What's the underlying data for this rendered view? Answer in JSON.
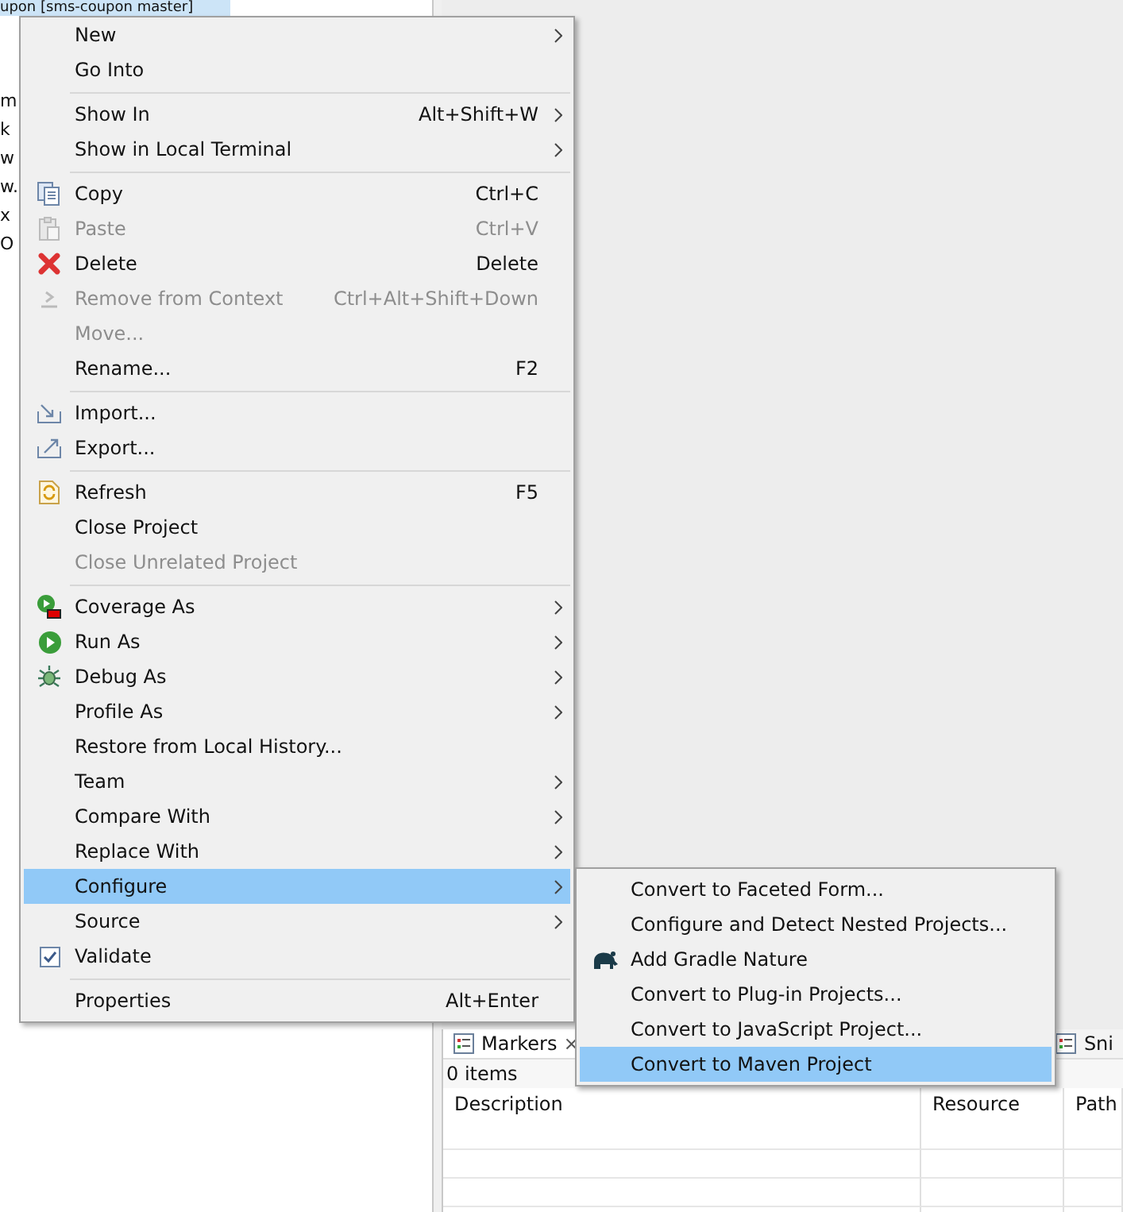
{
  "tree": {
    "selected_item": {
      "label": "upon [sms-coupon master]",
      "selected": true
    },
    "items": [
      {
        "label": "m"
      },
      {
        "label": "k"
      },
      {
        "label": "w"
      },
      {
        "label": "w."
      },
      {
        "label": "x"
      },
      {
        "label": "O"
      }
    ]
  },
  "context_menu": {
    "items": [
      {
        "kind": "item",
        "label": "New",
        "submenu": true,
        "disabled": false,
        "selected": false
      },
      {
        "kind": "item",
        "label": "Go Into",
        "submenu": false,
        "disabled": false,
        "selected": false
      },
      {
        "kind": "separator"
      },
      {
        "kind": "item",
        "label": "Show In",
        "shortcut": "Alt+Shift+W",
        "submenu": true,
        "disabled": false,
        "selected": false
      },
      {
        "kind": "item",
        "label": "Show in Local Terminal",
        "submenu": true,
        "disabled": false,
        "selected": false
      },
      {
        "kind": "separator"
      },
      {
        "kind": "item",
        "label": "Copy",
        "shortcut": "Ctrl+C",
        "submenu": false,
        "disabled": false,
        "selected": false
      },
      {
        "kind": "item",
        "label": "Paste",
        "shortcut": "Ctrl+V",
        "submenu": false,
        "disabled": true,
        "selected": false
      },
      {
        "kind": "item",
        "label": "Delete",
        "shortcut": "Delete",
        "submenu": false,
        "disabled": false,
        "selected": false
      },
      {
        "kind": "item",
        "label": "Remove from Context",
        "shortcut": "Ctrl+Alt+Shift+Down",
        "submenu": false,
        "disabled": true,
        "selected": false
      },
      {
        "kind": "item",
        "label": "Move...",
        "submenu": false,
        "disabled": true,
        "selected": false
      },
      {
        "kind": "item",
        "label": "Rename...",
        "shortcut": "F2",
        "submenu": false,
        "disabled": false,
        "selected": false
      },
      {
        "kind": "separator"
      },
      {
        "kind": "item",
        "label": "Import...",
        "submenu": false,
        "disabled": false,
        "selected": false
      },
      {
        "kind": "item",
        "label": "Export...",
        "submenu": false,
        "disabled": false,
        "selected": false
      },
      {
        "kind": "separator"
      },
      {
        "kind": "item",
        "label": "Refresh",
        "shortcut": "F5",
        "submenu": false,
        "disabled": false,
        "selected": false
      },
      {
        "kind": "item",
        "label": "Close Project",
        "submenu": false,
        "disabled": false,
        "selected": false
      },
      {
        "kind": "item",
        "label": "Close Unrelated Project",
        "submenu": false,
        "disabled": true,
        "selected": false
      },
      {
        "kind": "separator"
      },
      {
        "kind": "item",
        "label": "Coverage As",
        "submenu": true,
        "disabled": false,
        "selected": false
      },
      {
        "kind": "item",
        "label": "Run As",
        "submenu": true,
        "disabled": false,
        "selected": false
      },
      {
        "kind": "item",
        "label": "Debug As",
        "submenu": true,
        "disabled": false,
        "selected": false
      },
      {
        "kind": "item",
        "label": "Profile As",
        "submenu": true,
        "disabled": false,
        "selected": false
      },
      {
        "kind": "item",
        "label": "Restore from Local History...",
        "submenu": false,
        "disabled": false,
        "selected": false
      },
      {
        "kind": "item",
        "label": "Team",
        "submenu": true,
        "disabled": false,
        "selected": false
      },
      {
        "kind": "item",
        "label": "Compare With",
        "submenu": true,
        "disabled": false,
        "selected": false
      },
      {
        "kind": "item",
        "label": "Replace With",
        "submenu": true,
        "disabled": false,
        "selected": false
      },
      {
        "kind": "item",
        "label": "Configure",
        "submenu": true,
        "disabled": false,
        "selected": true
      },
      {
        "kind": "item",
        "label": "Source",
        "submenu": true,
        "disabled": false,
        "selected": false
      },
      {
        "kind": "item",
        "label": "Validate",
        "submenu": false,
        "disabled": false,
        "selected": false,
        "checked": true
      },
      {
        "kind": "separator"
      },
      {
        "kind": "item",
        "label": "Properties",
        "shortcut": "Alt+Enter",
        "submenu": false,
        "disabled": false,
        "selected": false
      }
    ]
  },
  "submenu": {
    "items": [
      {
        "label": "Convert to Faceted Form...",
        "selected": false
      },
      {
        "label": "Configure and Detect Nested Projects...",
        "selected": false
      },
      {
        "label": "Add Gradle Nature",
        "selected": false
      },
      {
        "label": "Convert to Plug-in Projects...",
        "selected": false
      },
      {
        "label": "Convert to JavaScript Project...",
        "selected": false
      },
      {
        "label": "Convert to Maven Project",
        "selected": true
      }
    ]
  },
  "markers_panel": {
    "tabs": [
      {
        "label": "Markers",
        "close": "×",
        "selected": true
      },
      {
        "label": "Sni",
        "selected": false
      }
    ],
    "count": "0 items",
    "columns": [
      "Description",
      "Resource",
      "Path"
    ]
  }
}
